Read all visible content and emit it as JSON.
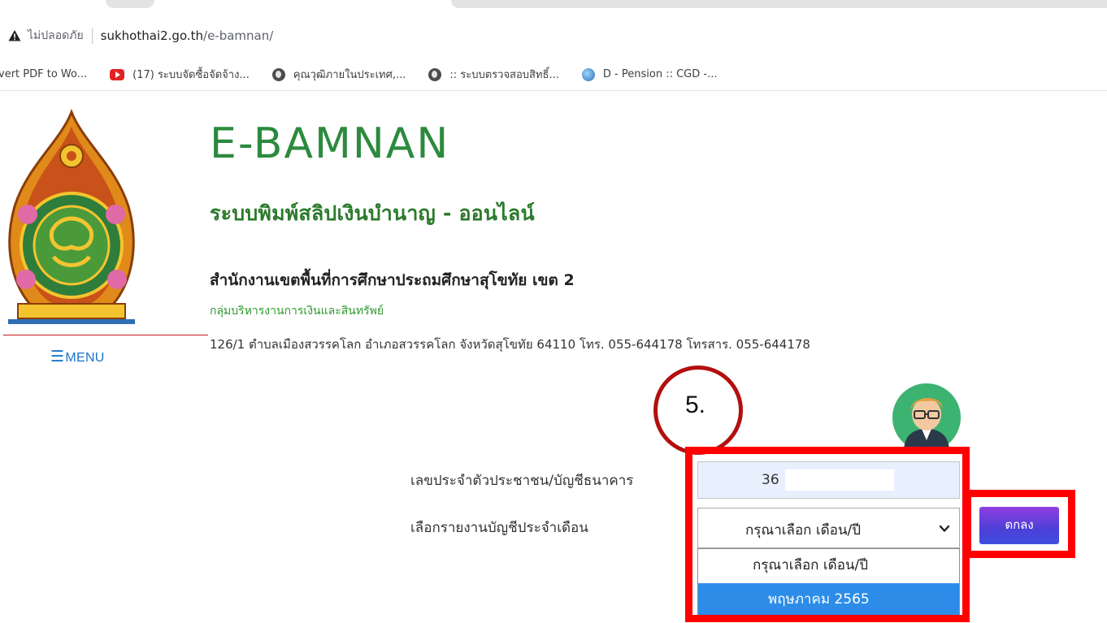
{
  "browser": {
    "security_label": "ไม่ปลอดภัย",
    "url_host": "sukhothai2.go.th",
    "url_path": "/e-bamnan/",
    "bookmarks": [
      {
        "label": "vert PDF to Wo...",
        "icon": "none"
      },
      {
        "label": "(17) ระบบจัดซื้อจัดจ้าง...",
        "icon": "youtube-icon"
      },
      {
        "label": "คุณวุฒิภายในประเทศ,...",
        "icon": "globe-icon"
      },
      {
        "label": ":: ระบบตรวจสอบสิทธิ์...",
        "icon": "globe-icon"
      },
      {
        "label": "D - Pension :: CGD -...",
        "icon": "d-pension-icon"
      }
    ]
  },
  "header": {
    "logo_text": "E-BAMNAN",
    "system_title": "ระบบพิมพ์สลิปเงินบำนาญ - ออนไลน์",
    "office_name": "สำนักงานเขตพื้นที่การศึกษาประถมศึกษาสุโขทัย เขต 2",
    "office_division": "กลุ่มบริหารงานการเงินและสินทรัพย์",
    "office_address": "126/1 ตำบลเมืองสวรรคโลก อำเภอสวรรคโลก จังหวัดสุโขทัย 64110 โทร. 055-644178 โทรสาร. 055-644178",
    "menu_label": "MENU"
  },
  "annotation": {
    "step_label": "5."
  },
  "form": {
    "id_label": "เลขประจำตัวประชาชน/บัญชีธนาคาร",
    "id_value": "36",
    "report_label": "เลือกรายงานบัญชีประจำเดือน",
    "selected_value": "กรุณาเลือก เดือน/ปี",
    "options": [
      "กรุณาเลือก เดือน/ปี",
      "พฤษภาคม 2565"
    ],
    "highlighted_option": "พฤษภาคม 2565",
    "submit_label": "ตกลง"
  },
  "colors": {
    "title_green": "#2c7a2c",
    "menu_blue": "#1a73c8",
    "annotation_red": "#ff0000",
    "option_highlight": "#2d8ce8",
    "button_purple": "#6a3fdc"
  }
}
